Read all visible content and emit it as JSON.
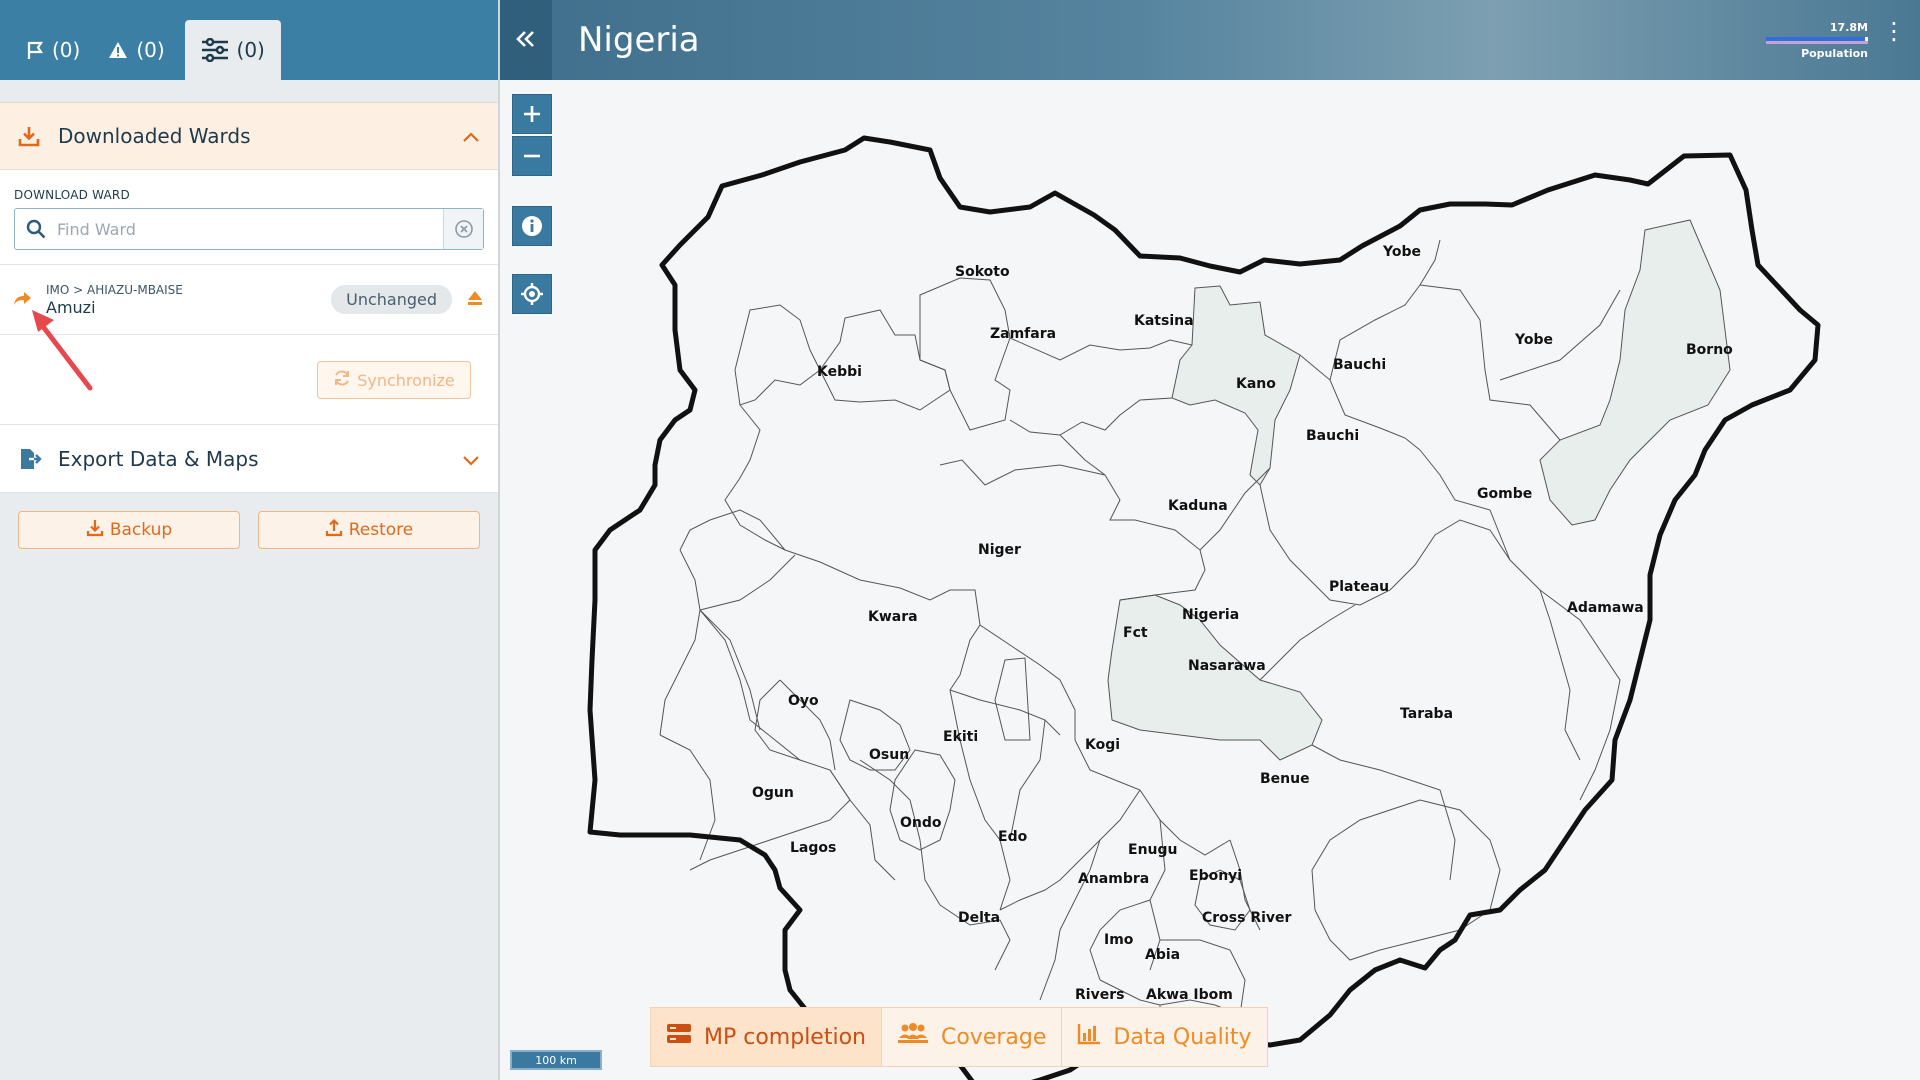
{
  "panel_tabs": [
    {
      "icon": "flag-icon",
      "count": "(0)"
    },
    {
      "icon": "warning-icon",
      "count": "(0)"
    },
    {
      "icon": "sliders-icon",
      "count": "(0)"
    }
  ],
  "downloaded_section": {
    "title": "Downloaded Wards",
    "download_label": "DOWNLOAD WARD",
    "search_placeholder": "Find Ward",
    "ward": {
      "path": "IMO > AHIAZU-MBAISE",
      "name": "Amuzi",
      "status": "Unchanged"
    },
    "sync_label": "Synchronize"
  },
  "export_section": {
    "title": "Export Data & Maps",
    "backup_label": "Backup",
    "restore_label": "Restore"
  },
  "header": {
    "title": "Nigeria",
    "population_value": "17.8M",
    "population_label": "Population",
    "population_fill": 0.97
  },
  "map": {
    "scale_label": "100 km",
    "highlighted_states": [
      "Kano",
      "Borno",
      "Nasarawa"
    ],
    "state_labels": [
      "Sokoto",
      "Zamfara",
      "Katsina",
      "Kebbi",
      "Kano",
      "Yobe",
      "Yobe",
      "Bauchi",
      "Borno",
      "Bauchi",
      "Kaduna",
      "Gombe",
      "Niger",
      "Plateau",
      "Kwara",
      "Nigeria",
      "Adamawa",
      "Fct",
      "Nasarawa",
      "Oyo",
      "Taraba",
      "Ekiti",
      "Osun",
      "Kogi",
      "Ogun",
      "Benue",
      "Ondo",
      "Edo",
      "Lagos",
      "Enugu",
      "Anambra",
      "Ebonyi",
      "Delta",
      "Cross River",
      "Imo",
      "Abia",
      "Rivers",
      "Akwa Ibom"
    ]
  },
  "bottom_tabs": [
    {
      "label": "MP completion",
      "icon": "server-icon",
      "active": true
    },
    {
      "label": "Coverage",
      "icon": "people-icon",
      "active": false
    },
    {
      "label": "Data Quality",
      "icon": "bar-chart-icon",
      "active": false
    }
  ],
  "colors": {
    "primary": "#3b7fa5",
    "accent_orange": "#f08a24",
    "highlight_fill": "#e8eeec"
  }
}
